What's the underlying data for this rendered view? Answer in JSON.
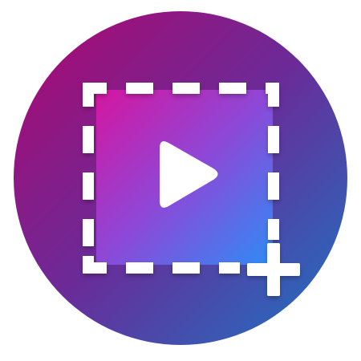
{
  "app_icon": {
    "name": "screen-video-recorder-app-icon",
    "colors": {
      "background_gradient_start": "#b0066f",
      "background_gradient_mid": "#6a2b98",
      "background_gradient_end": "#1a76c4",
      "inner_gradient_start": "#d5159f",
      "inner_gradient_mid": "#8d48d8",
      "inner_gradient_end": "#2f8bf5",
      "foreground": "#ffffff"
    },
    "glyphs": {
      "frame": "dashed-selection-frame-icon",
      "play": "play-icon",
      "badge": "plus-icon"
    }
  }
}
